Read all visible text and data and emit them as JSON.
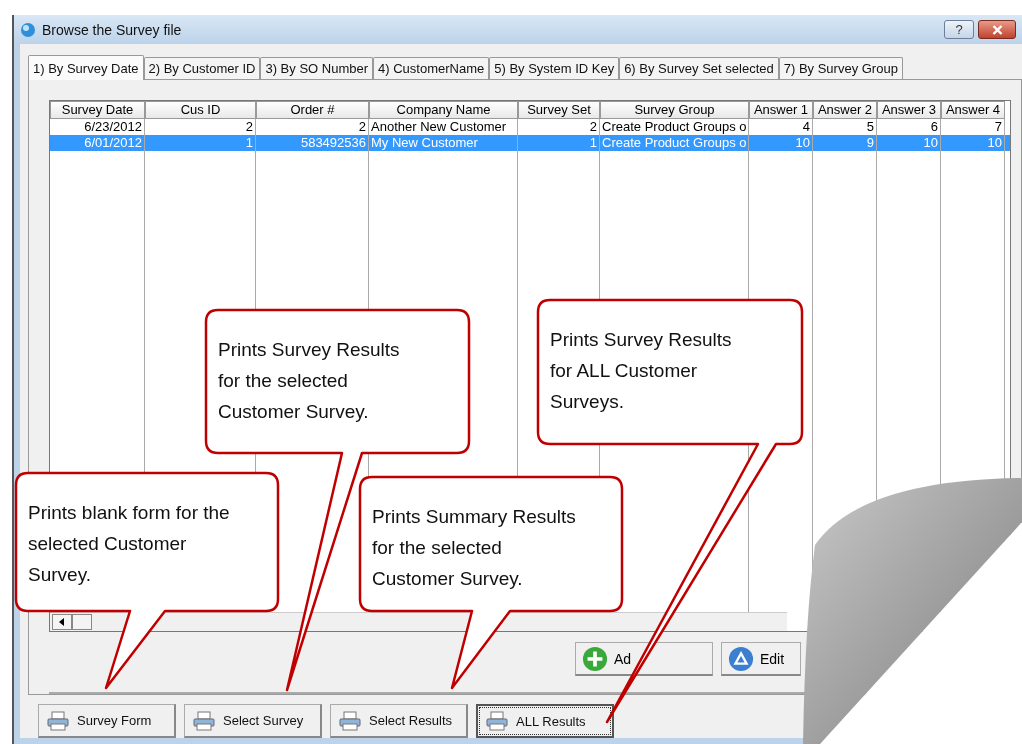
{
  "window": {
    "title": "Browse the Survey file",
    "help_label": "?"
  },
  "tabs": [
    {
      "label": "1) By Survey Date",
      "selected": true
    },
    {
      "label": "2) By Customer ID",
      "selected": false
    },
    {
      "label": "3) By SO Number",
      "selected": false
    },
    {
      "label": "4) CustomerName",
      "selected": false
    },
    {
      "label": "5) By System ID Key",
      "selected": false
    },
    {
      "label": "6) By Survey Set selected",
      "selected": false
    },
    {
      "label": "7) By Survey Group",
      "selected": false
    }
  ],
  "table": {
    "columns": [
      "Survey Date",
      "Cus ID",
      "Order #",
      "Company Name",
      "Survey Set",
      "Survey Group",
      "Answer 1",
      "Answer 2",
      "Answer 3",
      "Answer 4"
    ],
    "rows": [
      {
        "selected": false,
        "cells": [
          "6/23/2012",
          "2",
          "2",
          "Another New Customer",
          "2",
          "Create Product Groups o",
          "4",
          "5",
          "6",
          "7"
        ]
      },
      {
        "selected": true,
        "cells": [
          "6/01/2012",
          "1",
          "583492536",
          "My New Customer",
          "1",
          "Create Product Groups o",
          "10",
          "9",
          "10",
          "10"
        ]
      }
    ]
  },
  "record_buttons": [
    {
      "label": "Ad",
      "kind": "add"
    },
    {
      "label": "Edit",
      "kind": "edit"
    }
  ],
  "print_buttons": [
    {
      "label": "Survey Form",
      "focused": false
    },
    {
      "label": "Select Survey",
      "focused": false
    },
    {
      "label": "Select Results",
      "focused": false
    },
    {
      "label": "ALL Results",
      "focused": true
    }
  ],
  "callouts": [
    "Prints blank form for the\nselected Customer\nSurvey.",
    "Prints Survey Results\nfor the selected\nCustomer Survey.",
    "Prints Summary Results\nfor the selected\nCustomer Survey.",
    "Prints Survey Results\nfor ALL Customer\nSurveys."
  ]
}
